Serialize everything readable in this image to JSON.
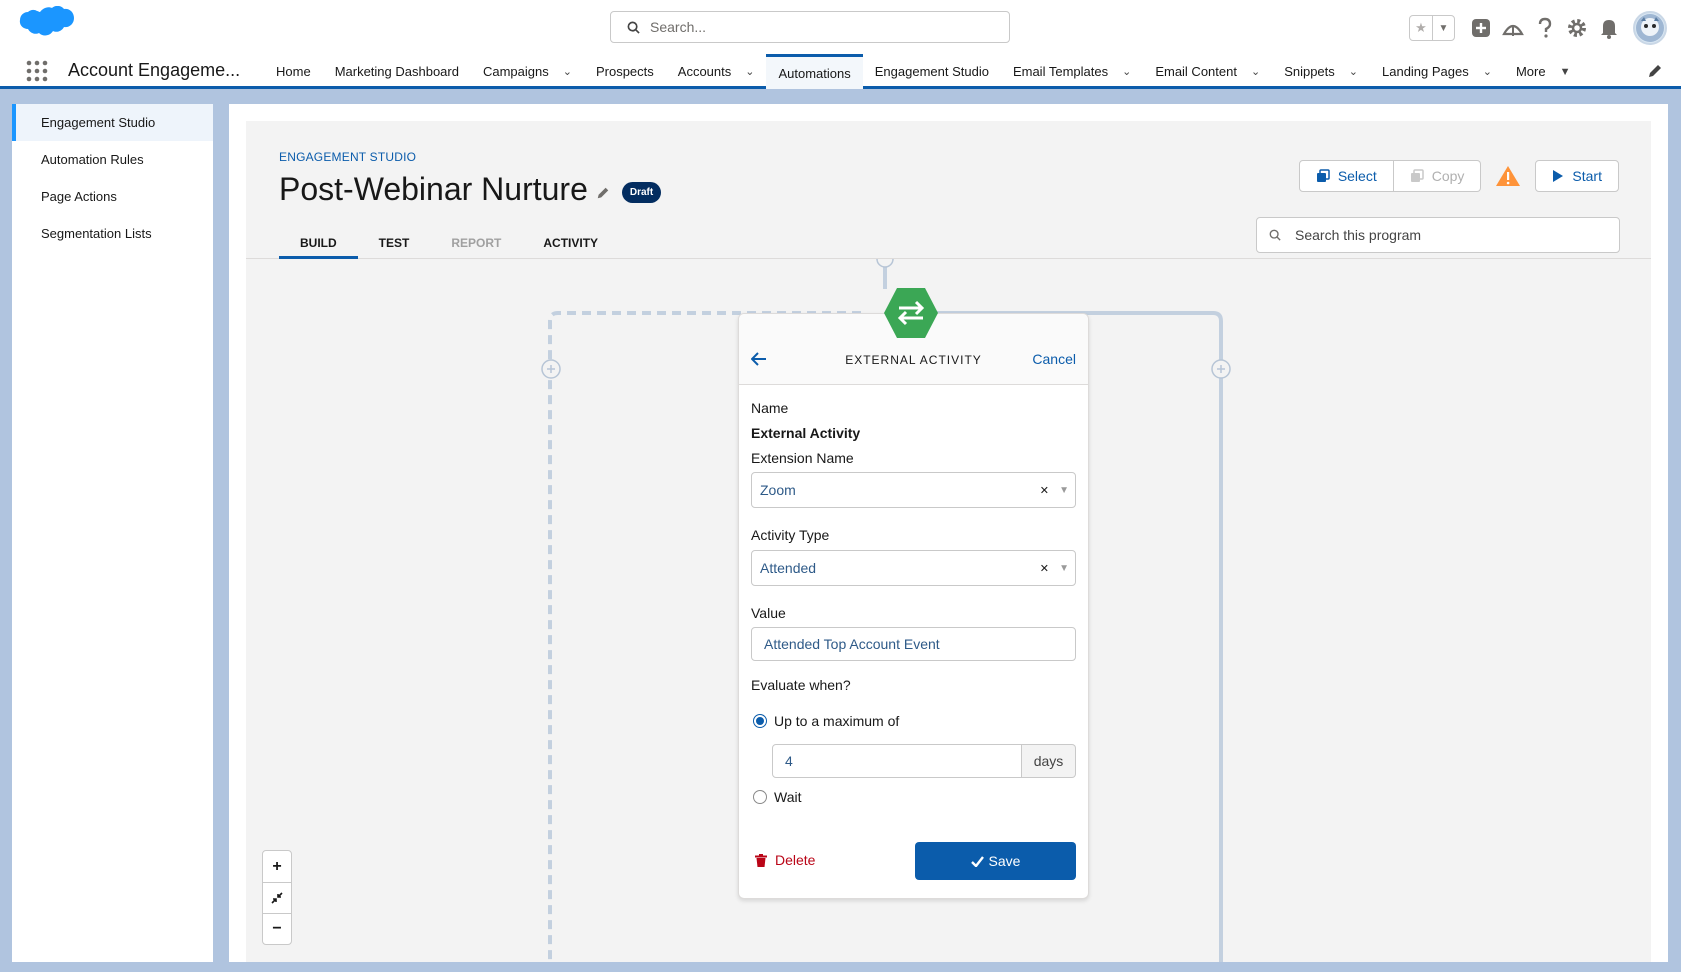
{
  "header": {
    "search_placeholder": "Search...",
    "app_name": "Account Engageme..."
  },
  "nav": {
    "items": [
      {
        "label": "Home",
        "dropdown": false
      },
      {
        "label": "Marketing Dashboard",
        "dropdown": false
      },
      {
        "label": "Campaigns",
        "dropdown": true
      },
      {
        "label": "Prospects",
        "dropdown": false
      },
      {
        "label": "Accounts",
        "dropdown": true
      },
      {
        "label": "Automations",
        "dropdown": false,
        "active": true
      },
      {
        "label": "Engagement Studio",
        "dropdown": false
      },
      {
        "label": "Email Templates",
        "dropdown": true
      },
      {
        "label": "Email Content",
        "dropdown": true
      },
      {
        "label": "Snippets",
        "dropdown": true
      },
      {
        "label": "Landing Pages",
        "dropdown": true
      },
      {
        "label": "More",
        "dropdown": true
      }
    ]
  },
  "sidebar": {
    "items": [
      {
        "label": "Engagement Studio",
        "active": true
      },
      {
        "label": "Automation Rules"
      },
      {
        "label": "Page Actions"
      },
      {
        "label": "Segmentation Lists"
      }
    ]
  },
  "studio": {
    "eyebrow": "ENGAGEMENT STUDIO",
    "title": "Post-Webinar Nurture",
    "badge": "Draft",
    "select_label": "Select",
    "copy_label": "Copy",
    "start_label": "Start",
    "search_placeholder": "Search this program",
    "tabs": [
      {
        "label": "BUILD",
        "active": true
      },
      {
        "label": "TEST"
      },
      {
        "label": "REPORT",
        "disabled": true
      },
      {
        "label": "ACTIVITY"
      }
    ]
  },
  "panel": {
    "title": "EXTERNAL ACTIVITY",
    "cancel": "Cancel",
    "name_label": "Name",
    "name_value": "External Activity",
    "extension_label": "Extension Name",
    "extension_value": "Zoom",
    "activity_type_label": "Activity Type",
    "activity_type_value": "Attended",
    "value_label": "Value",
    "value_value": "Attended Top Account Event",
    "evaluate_label": "Evaluate when?",
    "radio_max_label": "Up to a maximum of",
    "days_value": "4",
    "days_unit": "days",
    "radio_wait_label": "Wait",
    "delete_label": "Delete",
    "save_label": "Save"
  },
  "colors": {
    "brand_blue": "#0b5cab",
    "node_green": "#3ba755",
    "warning": "#fe9339",
    "delete_red": "#ba0517"
  },
  "icons": {
    "node": "swap-arrows-icon",
    "zoom_in": "plus-icon",
    "fit": "shrink-icon",
    "zoom_out": "minus-icon"
  }
}
